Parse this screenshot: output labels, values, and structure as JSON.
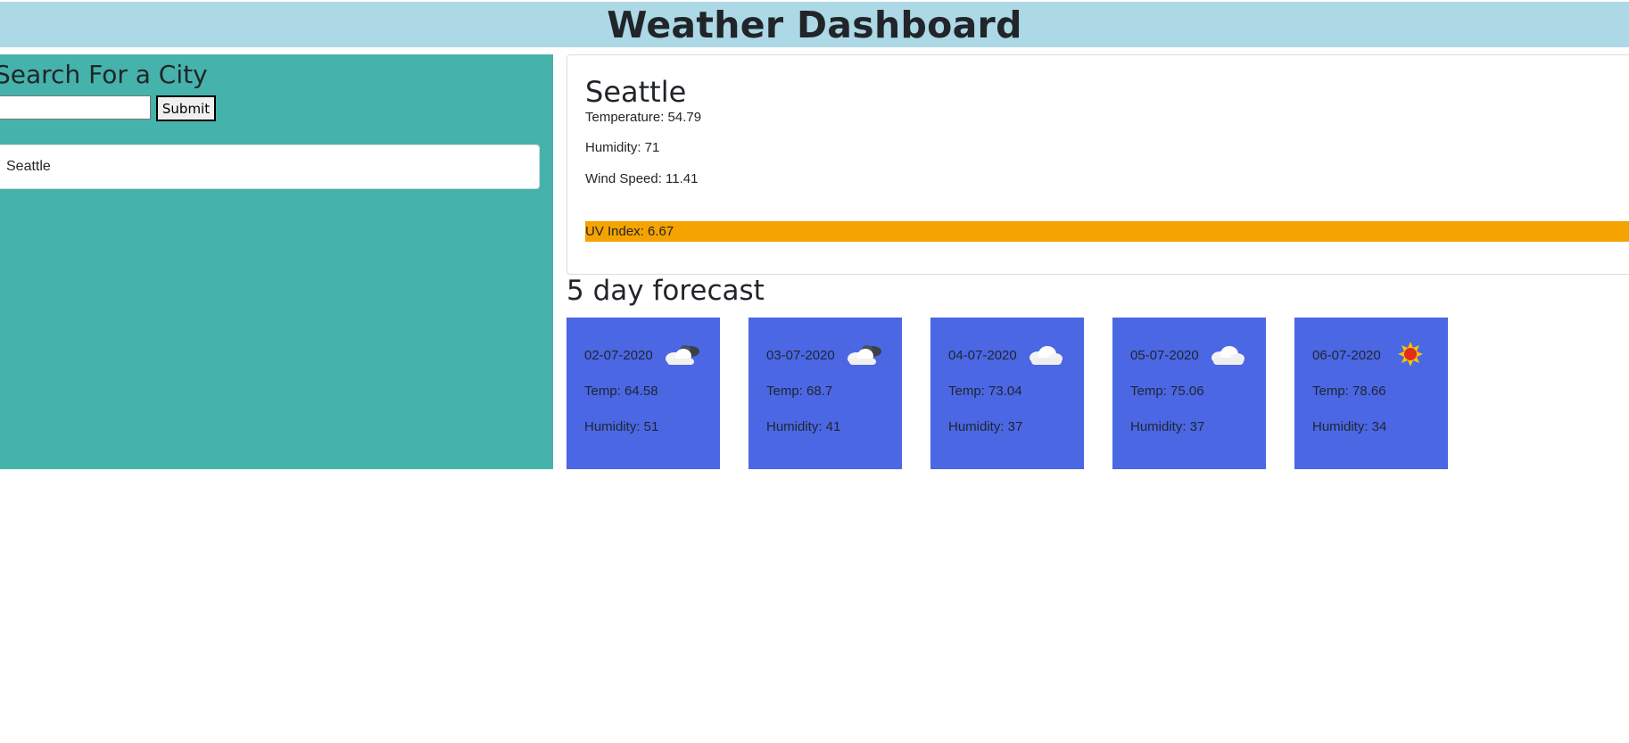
{
  "header": {
    "title": "Weather Dashboard"
  },
  "sidebar": {
    "heading": "Search For a City",
    "search_value": "",
    "submit_label": "Submit",
    "history": [
      "Seattle"
    ]
  },
  "current": {
    "city": "Seattle",
    "temperature": "Temperature: 54.79",
    "humidity": "Humidity: 71",
    "wind": "Wind Speed: 11.41",
    "uv": "UV Index: 6.67",
    "uv_color": "#f5a300"
  },
  "forecast": {
    "title": "5 day forecast",
    "card_color": "#4b67e3",
    "days": [
      {
        "date": "02-07-2020",
        "icon": "partly-cloudy-icon",
        "temp": "Temp: 64.58",
        "humidity": "Humidity: 51"
      },
      {
        "date": "03-07-2020",
        "icon": "partly-cloudy-icon",
        "temp": "Temp: 68.7",
        "humidity": "Humidity: 41"
      },
      {
        "date": "04-07-2020",
        "icon": "cloud-icon",
        "temp": "Temp: 73.04",
        "humidity": "Humidity: 37"
      },
      {
        "date": "05-07-2020",
        "icon": "cloud-icon",
        "temp": "Temp: 75.06",
        "humidity": "Humidity: 37"
      },
      {
        "date": "06-07-2020",
        "icon": "sun-icon",
        "temp": "Temp: 78.66",
        "humidity": "Humidity: 34"
      }
    ]
  },
  "colors": {
    "header_bg": "#add8e6",
    "sidebar_bg": "#45b3ab"
  }
}
